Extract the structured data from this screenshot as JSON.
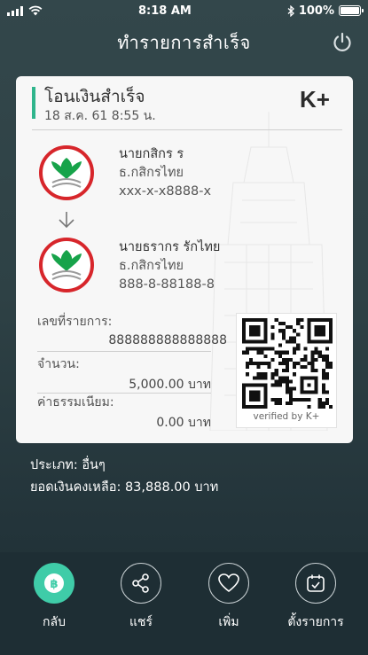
{
  "status_bar": {
    "time": "8:18 AM",
    "battery": "100%",
    "battery_level": 1.0
  },
  "header": {
    "title": "ทำรายการสำเร็จ"
  },
  "slip": {
    "title": "โอนเงินสำเร็จ",
    "datetime": "18 ส.ค. 61  8:55 น.",
    "brand": "K+",
    "sender": {
      "name": "นายกสิกร ร",
      "bank": "ธ.กสิกรไทย",
      "account": "xxx-x-x8888-x"
    },
    "receiver": {
      "name": "นายธรากร รักไทย",
      "bank": "ธ.กสิกรไทย",
      "account": "888-8-88188-8"
    },
    "ref_label": "เลขที่รายการ:",
    "ref_value": "888888888888888",
    "amount_label": "จำนวน:",
    "amount_value": "5,000.00 บาท",
    "fee_label": "ค่าธรรมเนียม:",
    "fee_value": "0.00 บาท",
    "verified": "verified by K+"
  },
  "info": {
    "type": "ประเภท: อื่นๆ",
    "balance": "ยอดเงินคงเหลือ: 83,888.00 บาท"
  },
  "bottom_nav": [
    {
      "label": "กลับ",
      "icon": "baht-coin-icon"
    },
    {
      "label": "แชร์",
      "icon": "share-icon"
    },
    {
      "label": "เพิ่ม",
      "icon": "heart-icon"
    },
    {
      "label": "ตั้งรายการ",
      "icon": "calendar-check-icon"
    }
  ],
  "colors": {
    "accent": "#3fcca8",
    "kbank_green": "#17a34a",
    "kbank_red": "#d7262b",
    "bg": "#2e4145"
  }
}
